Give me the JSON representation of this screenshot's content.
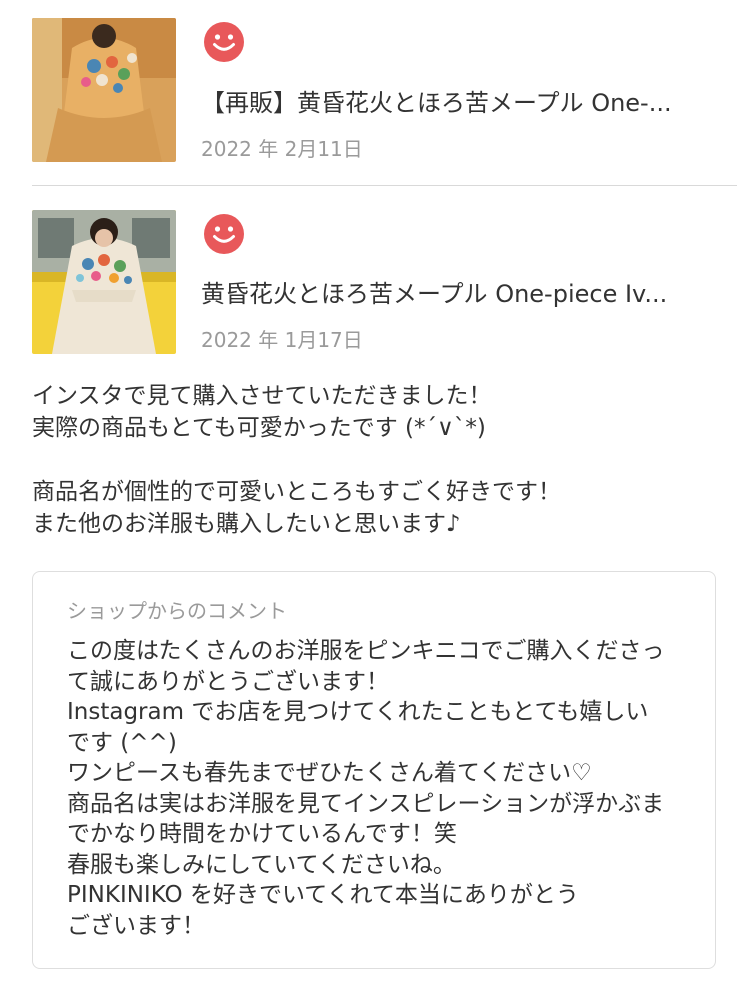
{
  "reviews": [
    {
      "rating_icon": "smiley-face-icon",
      "product_title": "【再販】黄昏花火とほろ苦メープル One-...",
      "date": "2022 年 2月11日"
    },
    {
      "rating_icon": "smiley-face-icon",
      "product_title": "黄昏花火とほろ苦メープル One-piece Iv...",
      "date": "2022 年 1月17日",
      "comment_lines": [
        "インスタで見て購入させていただきました！",
        "実際の商品もとても可愛かったです (*´∨`*)",
        "",
        "商品名が個性的で可愛いところもすごく好きです！",
        "また他のお洋服も購入したいと思います♪"
      ],
      "shop_reply": {
        "label": "ショップからのコメント",
        "lines": [
          "この度はたくさんのお洋服をピンキニコでご購入くださっ",
          "て誠にありがとうございます！",
          "Instagram でお店を見つけてくれたこともとても嬉しい",
          "です (^^)",
          "ワンピースも春先までぜひたくさん着てください♡",
          "商品名は実はお洋服を見てインスピレーションが浮かぶま",
          "でかなり時間をかけているんです！笑",
          "春服も楽しみにしていてくださいね。",
          "PINKINIKO を好きでいてくれて本当にありがとう",
          "ございます！"
        ]
      }
    }
  ],
  "colors": {
    "smiley": "#e8585a",
    "text": "#333333",
    "muted": "#9a9a9a",
    "border": "#dedede"
  }
}
